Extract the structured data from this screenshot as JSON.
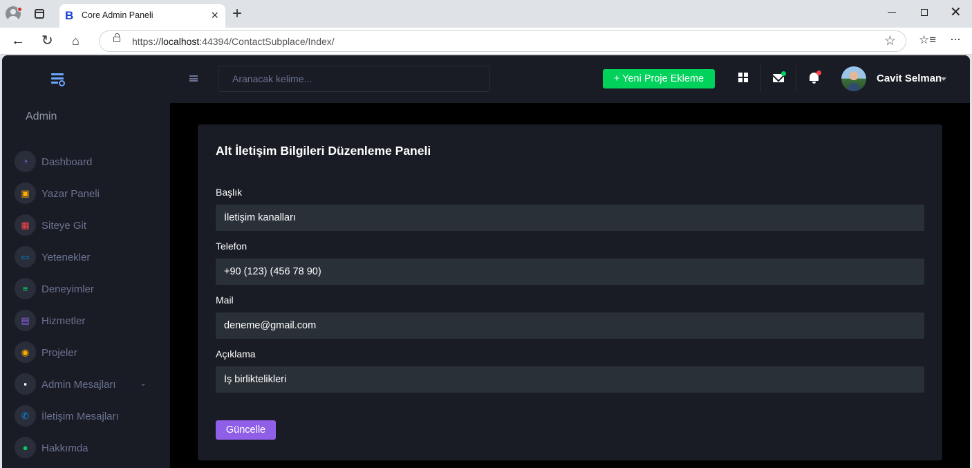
{
  "browser": {
    "tab_title": "Core Admin Paneli",
    "tab_favicon": "B",
    "url_prefix": "https://",
    "url_host": "localhost",
    "url_rest": ":44394/ContactSubplace/Index/"
  },
  "navbar": {
    "search_placeholder": "Aranacak kelime...",
    "new_project_label": "+ Yeni Proje Ekleme",
    "user_name": "Cavit Selman"
  },
  "sidebar": {
    "section_title": "Admin",
    "items": [
      {
        "label": "Dashboard",
        "icon": "speedometer-icon",
        "icon_glyph": "◔",
        "color": "#8f5fe8"
      },
      {
        "label": "Yazar Paneli",
        "icon": "presentation-icon",
        "icon_glyph": "▣",
        "color": "#ffab00"
      },
      {
        "label": "Siteye Git",
        "icon": "table-icon",
        "icon_glyph": "▦",
        "color": "#fc424a"
      },
      {
        "label": "Yetenekler",
        "icon": "laptop-icon",
        "icon_glyph": "▭",
        "color": "#0090e7"
      },
      {
        "label": "Deneyimler",
        "icon": "playlist-icon",
        "icon_glyph": "≡",
        "color": "#00d25b"
      },
      {
        "label": "Hizmetler",
        "icon": "contacts-icon",
        "icon_glyph": "▤",
        "color": "#8f5fe8"
      },
      {
        "label": "Projeler",
        "icon": "github-icon",
        "icon_glyph": "◉",
        "color": "#ffab00"
      },
      {
        "label": "Admin Mesajları",
        "icon": "message-icon",
        "icon_glyph": "▪",
        "color": "#ffffff"
      },
      {
        "label": "İletişim Mesajları",
        "icon": "phone-icon",
        "icon_glyph": "✆",
        "color": "#0090e7"
      },
      {
        "label": "Hakkımda",
        "icon": "account-icon",
        "icon_glyph": "●",
        "color": "#00d25b"
      }
    ]
  },
  "form": {
    "title": "Alt İletişim Bilgileri Düzenleme Paneli",
    "fields": [
      {
        "label": "Başlık",
        "value": "İletişim kanalları"
      },
      {
        "label": "Telefon",
        "value": "+90 (123) (456 78 90)"
      },
      {
        "label": "Mail",
        "value": "deneme@gmail.com"
      },
      {
        "label": "Açıklama",
        "value": "İş birliktelikleri"
      }
    ],
    "submit_label": "Güncelle"
  },
  "colors": {
    "primary": "#8f5fe8",
    "success": "#00d25b",
    "danger": "#fc424a",
    "sidebar_bg": "#191c24",
    "content_bg": "#000000",
    "input_bg": "#2a3038"
  }
}
